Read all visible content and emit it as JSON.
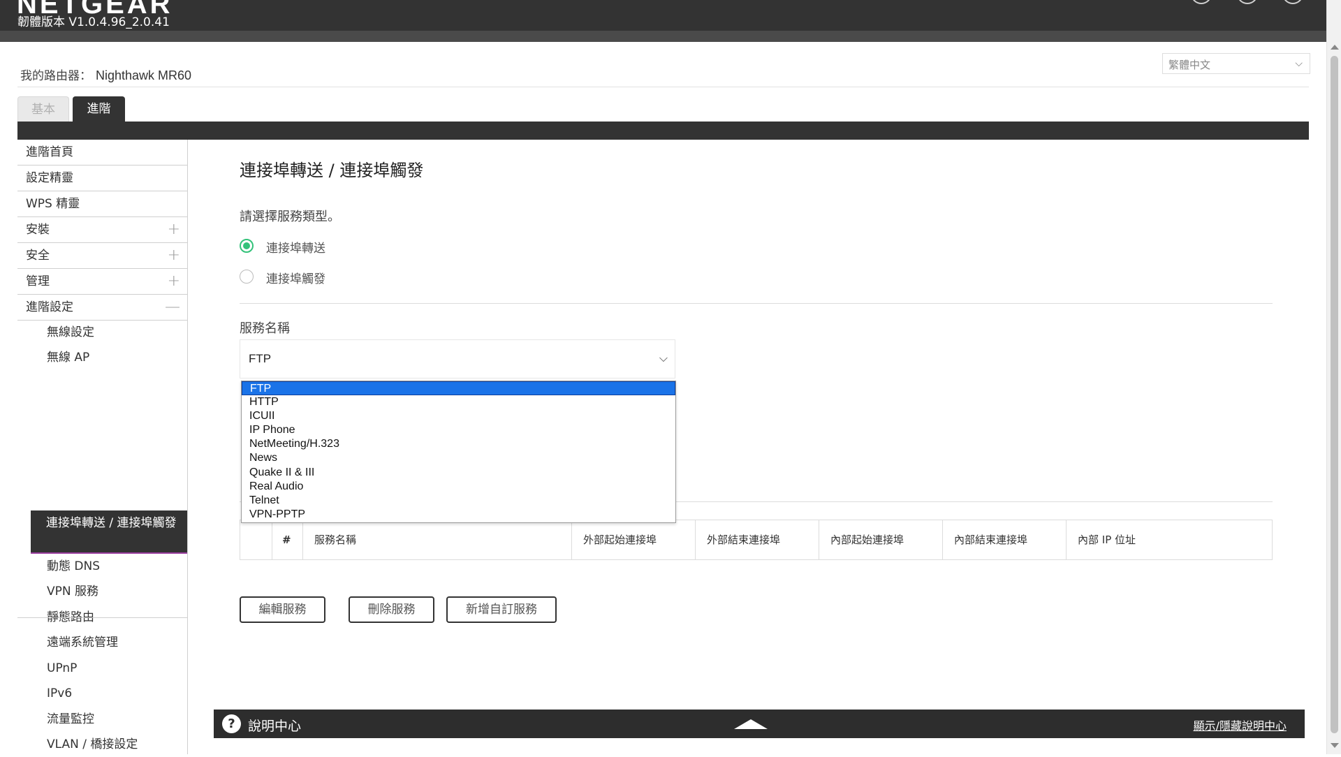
{
  "header": {
    "logo": "NETGEAR",
    "firmware": "韌體版本 V1.0.4.96_2.0.41"
  },
  "router": {
    "label": "我的路由器：",
    "name": "Nighthawk MR60"
  },
  "language": {
    "selected": "繁體中文"
  },
  "tabs": {
    "basic": "基本",
    "advanced": "進階"
  },
  "sidebar": {
    "items": [
      {
        "label": "進階首頁",
        "expander": ""
      },
      {
        "label": "設定精靈",
        "expander": ""
      },
      {
        "label": "WPS 精靈",
        "expander": ""
      },
      {
        "label": "安裝",
        "expander": "+"
      },
      {
        "label": "安全",
        "expander": "+"
      },
      {
        "label": "管理",
        "expander": "+"
      },
      {
        "label": "進階設定",
        "expander": "—"
      }
    ],
    "subitems": [
      "無線設定",
      "無線 AP",
      "連接埠轉送 / 連接埠觸發",
      "動態 DNS",
      "VPN 服務",
      "靜態路由",
      "遠端系統管理",
      "UPnP",
      "IPv6",
      "流量監控",
      "VLAN / 橋接設定"
    ]
  },
  "main": {
    "title": "連接埠轉送 / 連接埠觸發",
    "prompt": "請選擇服務類型。",
    "radio_forward": "連接埠轉送",
    "radio_trigger": "連接埠觸發",
    "service_label": "服務名稱",
    "service_value": "FTP",
    "service_options": [
      "FTP",
      "HTTP",
      "ICUII",
      "IP Phone",
      "NetMeeting/H.323",
      "News",
      "Quake II & III",
      "Real Audio",
      "Telnet",
      "VPN-PPTP"
    ],
    "table_headers": [
      "",
      "#",
      "服務名稱",
      "外部起始連接埠",
      "外部結束連接埠",
      "內部起始連接埠",
      "內部結束連接埠",
      "內部 IP 位址"
    ],
    "buttons": {
      "edit": "編輯服務",
      "delete": "刪除服務",
      "add": "新增自訂服務"
    }
  },
  "help": {
    "icon": "?",
    "label": "說明中心",
    "toggle": "顯示/隱藏說明中心"
  },
  "colors": {
    "header_bg": "#333333",
    "radio_accent": "#34c27a",
    "select_highlight": "#1a73e8",
    "active_underline": "#9b3ea0"
  }
}
